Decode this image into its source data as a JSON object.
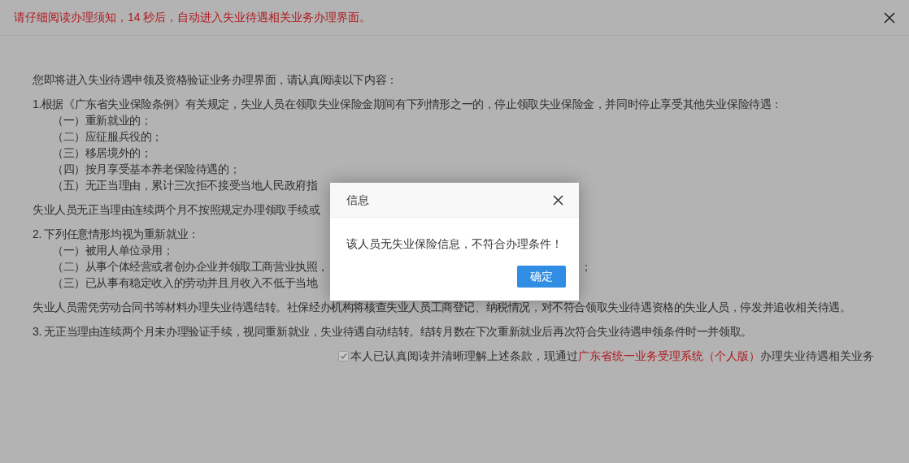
{
  "notice": {
    "text": "请仔细阅读办理须知，14 秒后，自动进入失业待遇相关业务办理界面。"
  },
  "blocks": [
    {
      "kind": "paragraph",
      "text": "您即将进入失业待遇申领及资格验证业务办理界面，请认真阅读以下内容："
    },
    {
      "kind": "paragraph",
      "text": "1.根据《广东省失业保险条例》有关规定，失业人员在领取失业保险金期间有下列情形之一的，停止领取失业保险金，并同时停止享受其他失业保险待遇："
    },
    {
      "kind": "item",
      "text": "（一）重新就业的；"
    },
    {
      "kind": "item",
      "text": "（二）应征服兵役的；"
    },
    {
      "kind": "item",
      "text": "（三）移居境外的；"
    },
    {
      "kind": "item",
      "text": "（四）按月享受基本养老保险待遇的；"
    },
    {
      "kind": "item",
      "text": "（五）无正当理由，累计三次拒不接受当地人民政府指"
    },
    {
      "kind": "paragraph",
      "text": "失业人员无正当理由连续两个月不按照规定办理领取手续或"
    },
    {
      "kind": "paragraph",
      "text": "2. 下列任意情形均视为重新就业："
    },
    {
      "kind": "item",
      "text": "（一）被用人单位录用；"
    },
    {
      "kind": "item",
      "text": "（二）从事个体经营或者创办企业并领取工商营业执照，",
      "text_right": "；"
    },
    {
      "kind": "item",
      "text": "（三）已从事有稳定收入的劳动并且月收入不低于当地"
    },
    {
      "kind": "paragraph",
      "text": "失业人员需凭劳动合同书等材料办理失业待遇结转。社保经办机构将核查失业人员工商登记、纳税情况，对不符合领取失业待遇资格的失业人员，停发并追收相关待遇。"
    },
    {
      "kind": "paragraph",
      "text": "3. 无正当理由连续两个月未办理验证手续，视同重新就业，失业待遇自动结转。结转月数在下次重新就业后再次符合失业待遇申领条件时一并领取。"
    }
  ],
  "agreement": {
    "checked": true,
    "text_before": "本人已认真阅读并清晰理解上述条款，现通过",
    "link": "广东省统一业务受理系统（个人版）",
    "text_after": "办理失业待遇相关业务"
  },
  "dialog": {
    "title": "信息",
    "message": "该人员无失业保险信息，不符合办理条件！",
    "button": "确定"
  }
}
